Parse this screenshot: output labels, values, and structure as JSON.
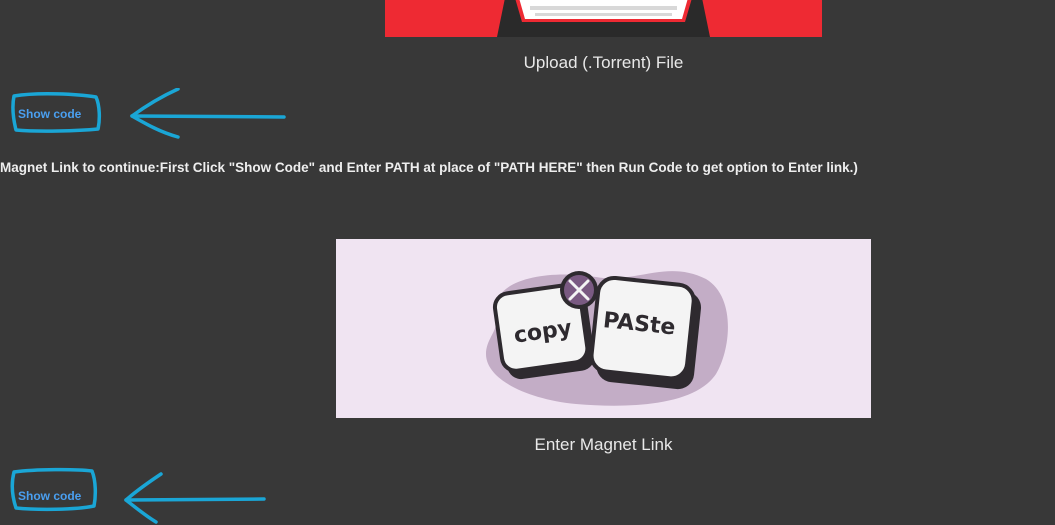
{
  "upload_section": {
    "image_icon": "laptop-upload-icon",
    "caption": "Upload (.Torrent) File",
    "show_code_label": "Show code"
  },
  "instruction": {
    "text": "ter Magnet Link to continue:First Click \"Show Code\" and Enter PATH at place of \"PATH HERE\" then Run Code to get option to Enter link.)"
  },
  "magnet_section": {
    "image_icon": "copy-paste-keys-icon",
    "image_text": {
      "copy": "copy",
      "paste": "PASte"
    },
    "caption": "Enter Magnet Link",
    "show_code_label": "Show code"
  },
  "colors": {
    "background": "#383838",
    "link": "#4a9ff0",
    "annotation": "#1aa6d6",
    "torrent_bg": "#ee2a33",
    "copy_paste_bg": "#f0e4f2"
  }
}
